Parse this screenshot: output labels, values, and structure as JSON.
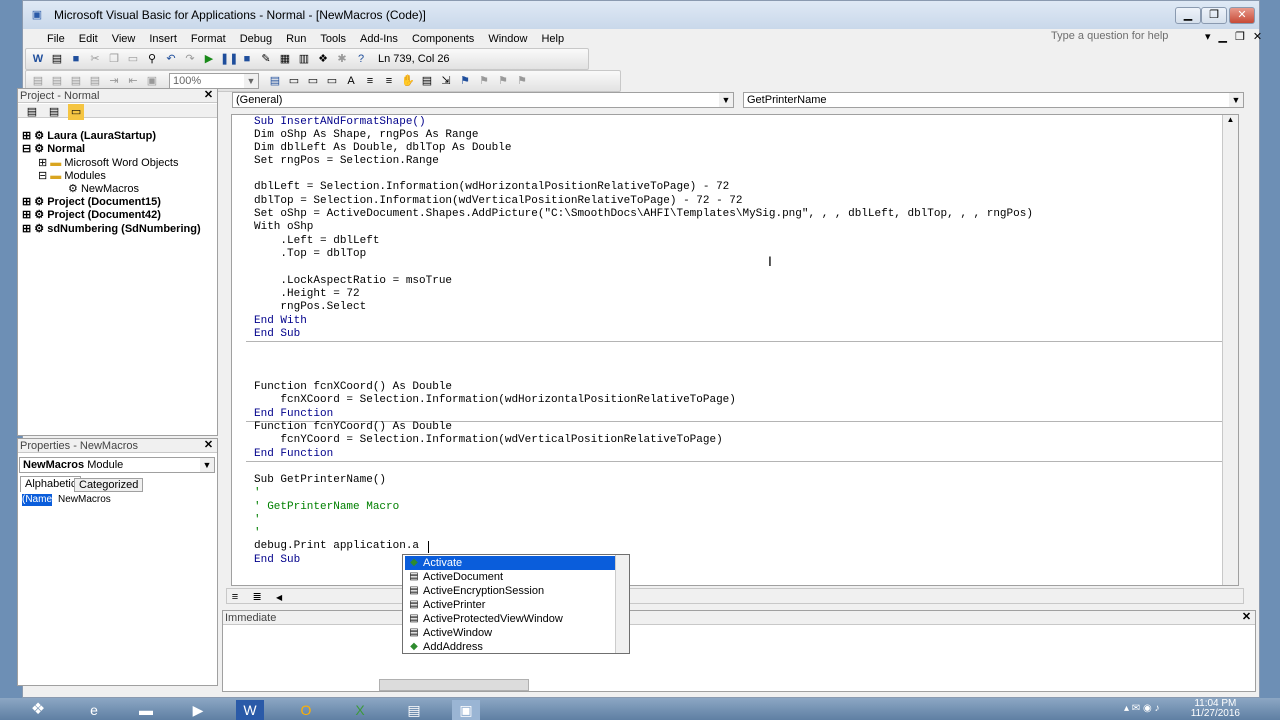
{
  "window": {
    "title": "Microsoft Visual Basic for Applications - Normal - [NewMacros (Code)]"
  },
  "menu": [
    "File",
    "Edit",
    "View",
    "Insert",
    "Format",
    "Debug",
    "Run",
    "Tools",
    "Add-Ins",
    "Components",
    "Window",
    "Help"
  ],
  "help_placeholder": "Type a question for help",
  "toolbar": {
    "position": "Ln 739, Col 26",
    "zoom": "100%"
  },
  "project": {
    "title": "Project - Normal",
    "items": [
      "Laura (LauraStartup)",
      "Normal",
      "Microsoft Word Objects",
      "Modules",
      "NewMacros",
      "Project (Document15)",
      "Project (Document42)",
      "sdNumbering (SdNumbering)"
    ]
  },
  "properties": {
    "title": "Properties - NewMacros",
    "object": "NewMacros",
    "object_type": "Module",
    "tabs": [
      "Alphabetic",
      "Categorized"
    ],
    "name_key": "(Name)",
    "name_value": "NewMacros"
  },
  "code": {
    "object_combo": "(General)",
    "proc_combo": "GetPrinterName",
    "lines": [
      "Sub InsertANdFormatShape()",
      "Dim oShp As Shape, rngPos As Range",
      "Dim dblLeft As Double, dblTop As Double",
      "Set rngPos = Selection.Range",
      "",
      "dblLeft = Selection.Information(wdHorizontalPositionRelativeToPage) - 72",
      "dblTop = Selection.Information(wdVerticalPositionRelativeToPage) - 72 - 72",
      "Set oShp = ActiveDocument.Shapes.AddPicture(\"C:\\SmoothDocs\\AHFI\\Templates\\MySig.png\", , , dblLeft, dblTop, , , rngPos)",
      "With oShp",
      "    .Left = dblLeft",
      "    .Top = dblTop",
      "",
      "    .LockAspectRatio = msoTrue",
      "    .Height = 72",
      "    rngPos.Select",
      "End With",
      "End Sub",
      "Function fcnXCoord() As Double",
      "    fcnXCoord = Selection.Information(wdHorizontalPositionRelativeToPage)",
      "End Function",
      "Function fcnYCoord() As Double",
      "    fcnYCoord = Selection.Information(wdVerticalPositionRelativeToPage)",
      "End Function",
      "Sub GetPrinterName()",
      "'",
      "' GetPrinterName Macro",
      "'",
      "'",
      "debug.Print application.a",
      "End Sub"
    ]
  },
  "autocomplete": [
    "Activate",
    "ActiveDocument",
    "ActiveEncryptionSession",
    "ActivePrinter",
    "ActiveProtectedViewWindow",
    "ActiveWindow",
    "AddAddress"
  ],
  "immediate": {
    "title": "Immediate"
  },
  "clock": {
    "time": "11:04 PM",
    "date": "11/27/2016"
  }
}
